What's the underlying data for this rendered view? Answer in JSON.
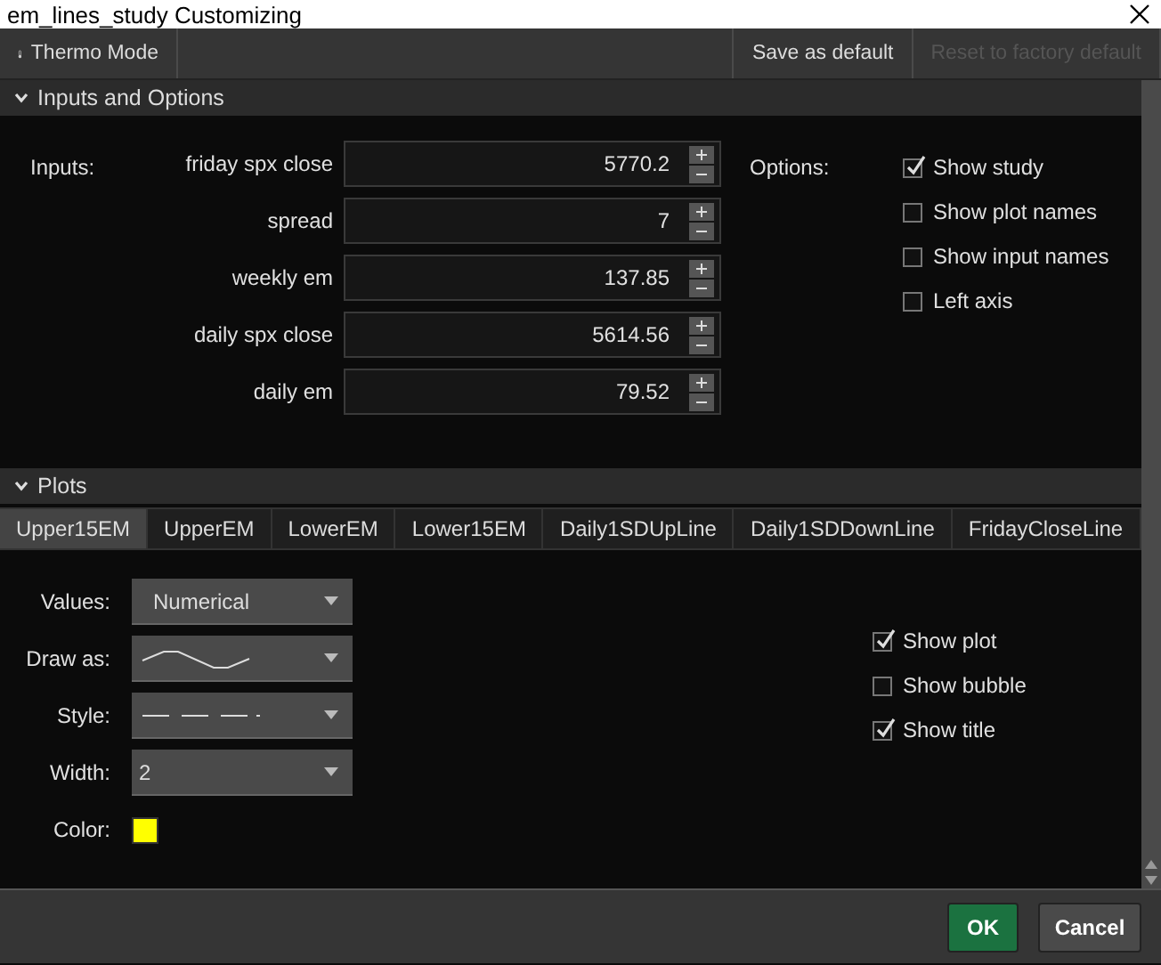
{
  "window": {
    "title": "em_lines_study Customizing"
  },
  "toolbar": {
    "mode_button": "Thermo Mode",
    "save_default": "Save as default",
    "reset_default": {
      "label": "Reset to factory default",
      "disabled": true
    }
  },
  "inputs_section": {
    "title": "Inputs and Options",
    "expanded": true,
    "inputs_label": "Inputs:",
    "inputs": [
      {
        "name": "friday spx close",
        "value": "5770.2"
      },
      {
        "name": "spread",
        "value": "7"
      },
      {
        "name": "weekly em",
        "value": "137.85"
      },
      {
        "name": "daily spx close",
        "value": "5614.56"
      },
      {
        "name": "daily em",
        "value": "79.52"
      }
    ],
    "options_label": "Options:",
    "options": [
      {
        "label": "Show study",
        "checked": true
      },
      {
        "label": "Show plot names",
        "checked": false
      },
      {
        "label": "Show input names",
        "checked": false
      },
      {
        "label": "Left axis",
        "checked": false
      }
    ]
  },
  "plots_section": {
    "title": "Plots",
    "expanded": true,
    "tabs": [
      {
        "label": "Upper15EM",
        "selected": true
      },
      {
        "label": "UpperEM",
        "selected": false
      },
      {
        "label": "LowerEM",
        "selected": false
      },
      {
        "label": "Lower15EM",
        "selected": false
      },
      {
        "label": "Daily1SDUpLine",
        "selected": false
      },
      {
        "label": "Daily1SDDownLine",
        "selected": false
      },
      {
        "label": "FridayCloseLine",
        "selected": false
      }
    ],
    "settings": [
      {
        "label": "Values:",
        "kind": "text",
        "value": "Numerical"
      },
      {
        "label": "Draw as:",
        "kind": "curve"
      },
      {
        "label": "Style:",
        "kind": "dashes"
      },
      {
        "label": "Width:",
        "kind": "text",
        "value": "2"
      },
      {
        "label": "Color:",
        "kind": "color",
        "color": "#ffff00"
      }
    ],
    "options": [
      {
        "label": "Show plot",
        "checked": true
      },
      {
        "label": "Show bubble",
        "checked": false
      },
      {
        "label": "Show title",
        "checked": true
      }
    ]
  },
  "buttons": [
    {
      "label": "OK",
      "kind": "primary"
    },
    {
      "label": "Cancel",
      "kind": "secondary"
    }
  ]
}
